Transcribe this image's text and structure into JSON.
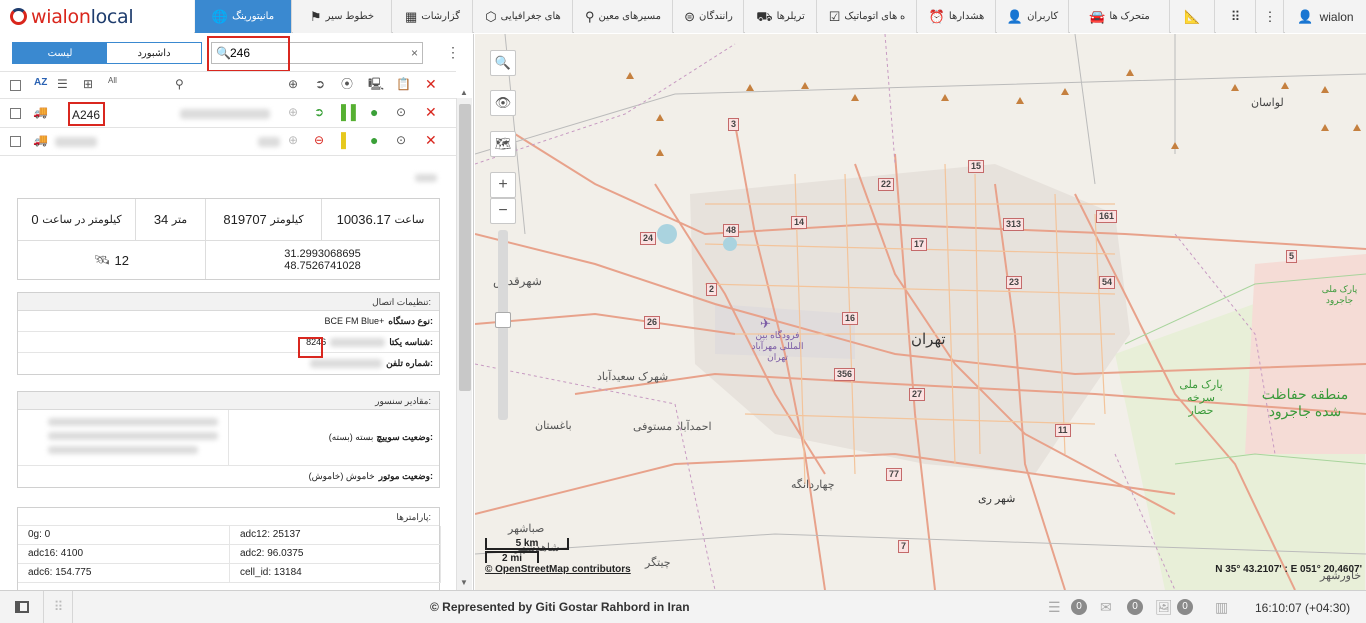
{
  "topbar": {
    "logo_left": "wialon",
    "logo_right": "local",
    "username": "wialon",
    "tabs": [
      {
        "label": "مانیتورینگ",
        "icon": "globe-icon",
        "active": true
      },
      {
        "label": "خطوط سیر",
        "icon": "flag-icon"
      },
      {
        "label": "گزارشات",
        "icon": "table-icon"
      },
      {
        "label": "های جغرافیایی",
        "icon": "geofence-icon"
      },
      {
        "label": "مسیرهای معین",
        "icon": "route-icon"
      },
      {
        "label": "رانندگان",
        "icon": "steering-wheel-icon"
      },
      {
        "label": "تریلرها",
        "icon": "truck-trailer-icon"
      },
      {
        "label": "ه های اتوماتیک",
        "icon": "clipboard-check-icon"
      },
      {
        "label": "هشدارها",
        "icon": "alarm-clock-icon"
      },
      {
        "label": "کاربران",
        "icon": "user-icon"
      },
      {
        "label": "متحرک ها",
        "icon": "car-icon"
      }
    ]
  },
  "panel": {
    "view_list": "لیست",
    "view_dashboard": "داشبورد",
    "search_value": "246",
    "units": [
      {
        "name": "A246",
        "status_color": "#7cbb3c"
      },
      {
        "name": "",
        "status_color": "#e0473a"
      }
    ],
    "stats": {
      "engine_hours": "10036.17",
      "engine_hours_unit": "ساعت",
      "mileage": "819707",
      "mileage_unit": "کیلومتر",
      "altitude": "34",
      "altitude_unit": "متر",
      "speed": "0",
      "speed_unit": "کیلومتر در ساعت",
      "lat": "31.2993068695",
      "lon": "48.7526741028",
      "satellites": "12"
    },
    "connection": {
      "title": "تنظیمات اتصال:",
      "device_type_label": "نوع دستگاه:",
      "device_type_value": "BCE FM Blue+",
      "uid_label": "شناسه یکتا:",
      "uid_value": "8246",
      "phone_label": "شماره تلفن:"
    },
    "sensors": {
      "title": "مقادیر سنسور:",
      "switch_label": "وضعیت سوییچ:",
      "switch_value": "بسته (بسته)",
      "engine_label": "وضعیت موتور:",
      "engine_value": "خاموش (خاموش)"
    },
    "params": {
      "title": "پارامترها:",
      "items": [
        "0g: 0",
        "adc12: 25137",
        "adc16: 4100",
        "adc2: 96.0375",
        "adc6: 154.775",
        "cell_id: 13184"
      ]
    }
  },
  "map": {
    "scale_km": "5 km",
    "scale_mi": "2 mi",
    "attribution": "© OpenStreetMap contributors",
    "coords": "N 35° 43.2107' : E 051° 20.4607'",
    "labels": {
      "tehran": "تهران",
      "shahriar": "شهرقدس",
      "airport": "فرودگاه بین المللی مهرآباد تهران",
      "saeedabad": "شهرک سعیدآباد",
      "baghestan": "باغستان",
      "ahmadabad": "احمدآباد مستوفی",
      "chahardangeh": "چهاردانگه",
      "shahr_rey": "شهر ری",
      "lavasan": "لواسان",
      "park_hesar": "پارک ملی سرخه حصار",
      "park_jajrood": "منطقه حفاظت شده جاجرود",
      "park_jajrood_top": "پارک ملی جاجرود",
      "sabashahr": "صباشهر",
      "shahedshahr": "شاهدشهر",
      "khavarshahr": "خاورشهر",
      "chitgar": "چیتگر"
    },
    "shields": [
      "3",
      "15",
      "22",
      "14",
      "17",
      "313",
      "161",
      "48",
      "24",
      "2",
      "23",
      "54",
      "5",
      "16",
      "26",
      "356",
      "27",
      "11",
      "77",
      "7"
    ]
  },
  "footer": {
    "copyright": "© Represented by Giti Gostar Rahbord in Iran",
    "time": "16:10:07 (+04:30)",
    "messages_count": "0",
    "mail_count": "0",
    "images_count": "0"
  }
}
